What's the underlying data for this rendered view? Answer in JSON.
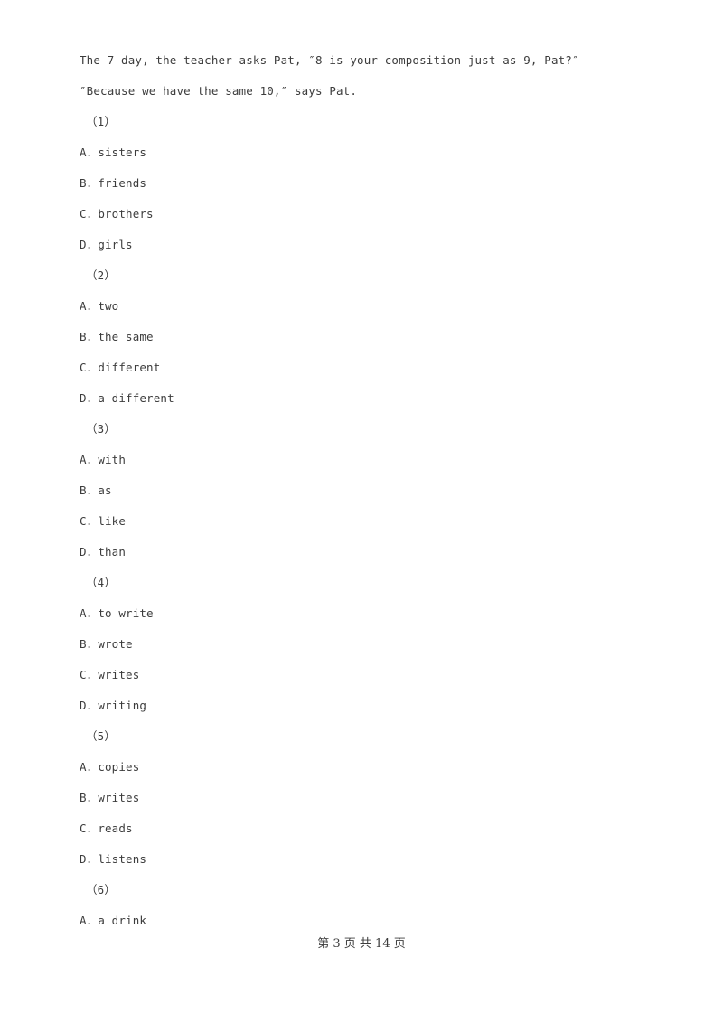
{
  "document": {
    "passage_lines": [
      "The 7 day, the teacher asks Pat, ″8 is your composition just as 9, Pat?″",
      "″Because we have the same 10,″ says Pat."
    ],
    "questions": [
      {
        "label": "（1）",
        "options": [
          "A．sisters",
          "B．friends",
          "C．brothers",
          "D．girls"
        ]
      },
      {
        "label": "（2）",
        "options": [
          "A．two",
          "B．the same",
          "C．different",
          "D．a different"
        ]
      },
      {
        "label": "（3）",
        "options": [
          "A．with",
          "B．as",
          "C．like",
          "D．than"
        ]
      },
      {
        "label": "（4）",
        "options": [
          "A．to write",
          "B．wrote",
          "C．writes",
          "D．writing"
        ]
      },
      {
        "label": "（5）",
        "options": [
          "A．copies",
          "B．writes",
          "C．reads",
          "D．listens"
        ]
      },
      {
        "label": "（6）",
        "options": [
          "A．a drink"
        ]
      }
    ]
  },
  "footer": {
    "page_text": "第 3 页 共 14 页",
    "current_page": 3,
    "total_pages": 14
  },
  "colors": {
    "page_background": "#ffffff",
    "text": "#3c3c3c"
  }
}
